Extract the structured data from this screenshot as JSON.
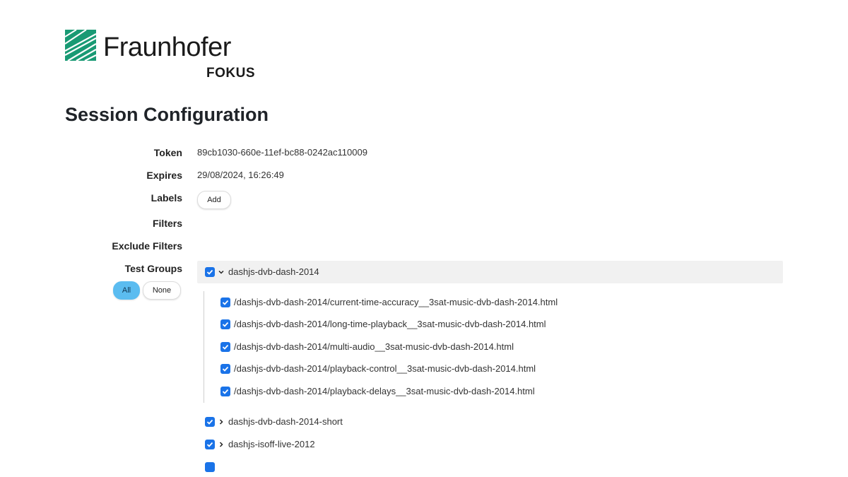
{
  "brand": {
    "name": "Fraunhofer",
    "sub": "FOKUS",
    "color": "#199a74"
  },
  "page_title": "Session Configuration",
  "fields": {
    "token_label": "Token",
    "token_value": "89cb1030-660e-11ef-bc88-0242ac110009",
    "expires_label": "Expires",
    "expires_value": "29/08/2024, 16:26:49",
    "labels_label": "Labels",
    "labels_add": "Add",
    "filters_label": "Filters",
    "exclude_filters_label": "Exclude Filters",
    "test_groups_label": "Test Groups",
    "all_button": "All",
    "none_button": "None"
  },
  "groups": [
    {
      "name": "dashjs-dvb-dash-2014",
      "checked": true,
      "expanded": true,
      "tests": [
        "/dashjs-dvb-dash-2014/current-time-accuracy__3sat-music-dvb-dash-2014.html",
        "/dashjs-dvb-dash-2014/long-time-playback__3sat-music-dvb-dash-2014.html",
        "/dashjs-dvb-dash-2014/multi-audio__3sat-music-dvb-dash-2014.html",
        "/dashjs-dvb-dash-2014/playback-control__3sat-music-dvb-dash-2014.html",
        "/dashjs-dvb-dash-2014/playback-delays__3sat-music-dvb-dash-2014.html"
      ]
    },
    {
      "name": "dashjs-dvb-dash-2014-short",
      "checked": true,
      "expanded": false
    },
    {
      "name": "dashjs-isoff-live-2012",
      "checked": true,
      "expanded": false
    }
  ],
  "colors": {
    "checkbox": "#1a73e8",
    "all_active": "#5bbcf0",
    "group_header_bg": "#f1f1f1"
  }
}
